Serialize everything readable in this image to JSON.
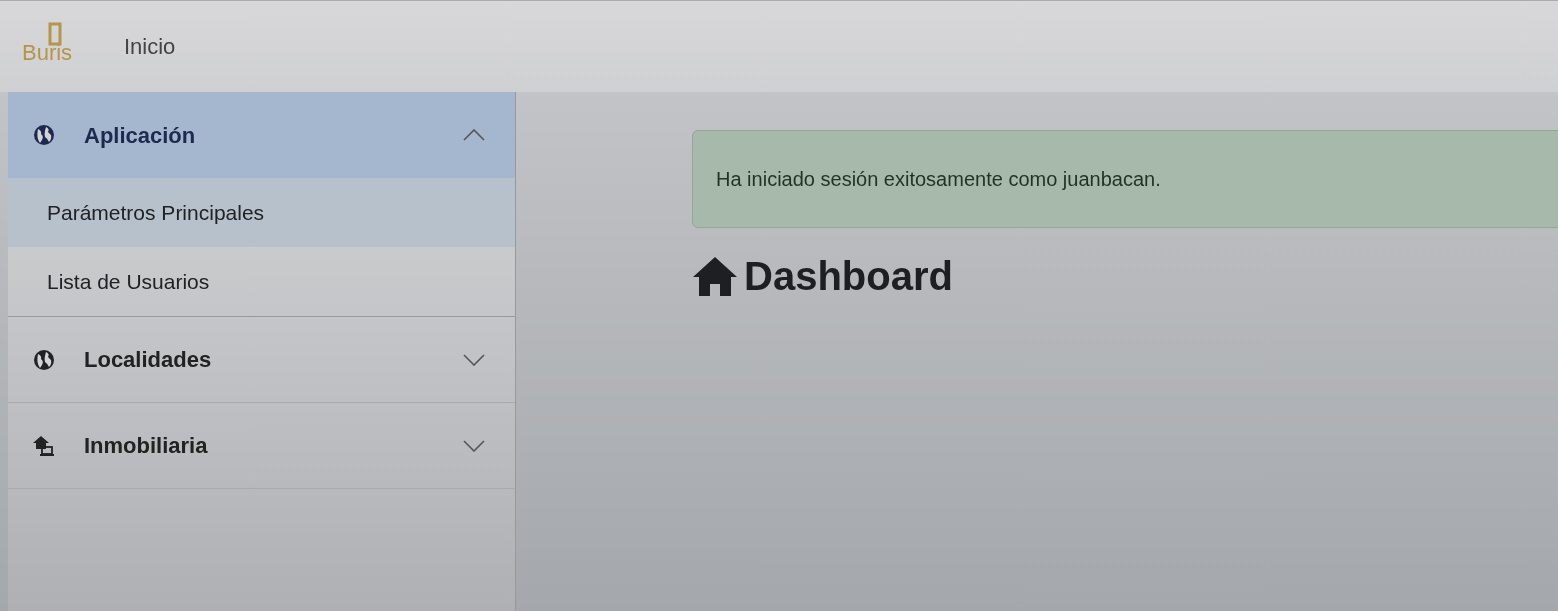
{
  "navbar": {
    "logo": "Buris",
    "link": "Inicio"
  },
  "sidebar": {
    "sections": [
      {
        "title": "Aplicación",
        "kind": "globe",
        "expanded": true,
        "children": [
          {
            "label": "Parámetros Principales",
            "selected": true
          },
          {
            "label": "Lista de Usuarios",
            "selected": false
          }
        ]
      },
      {
        "title": "Localidades",
        "kind": "globe",
        "expanded": false
      },
      {
        "title": "Inmobiliaria",
        "kind": "realty",
        "expanded": false
      }
    ]
  },
  "alert": {
    "text": "Ha iniciado sesión exitosamente como juanbacan."
  },
  "heading": {
    "text": "Dashboard"
  }
}
